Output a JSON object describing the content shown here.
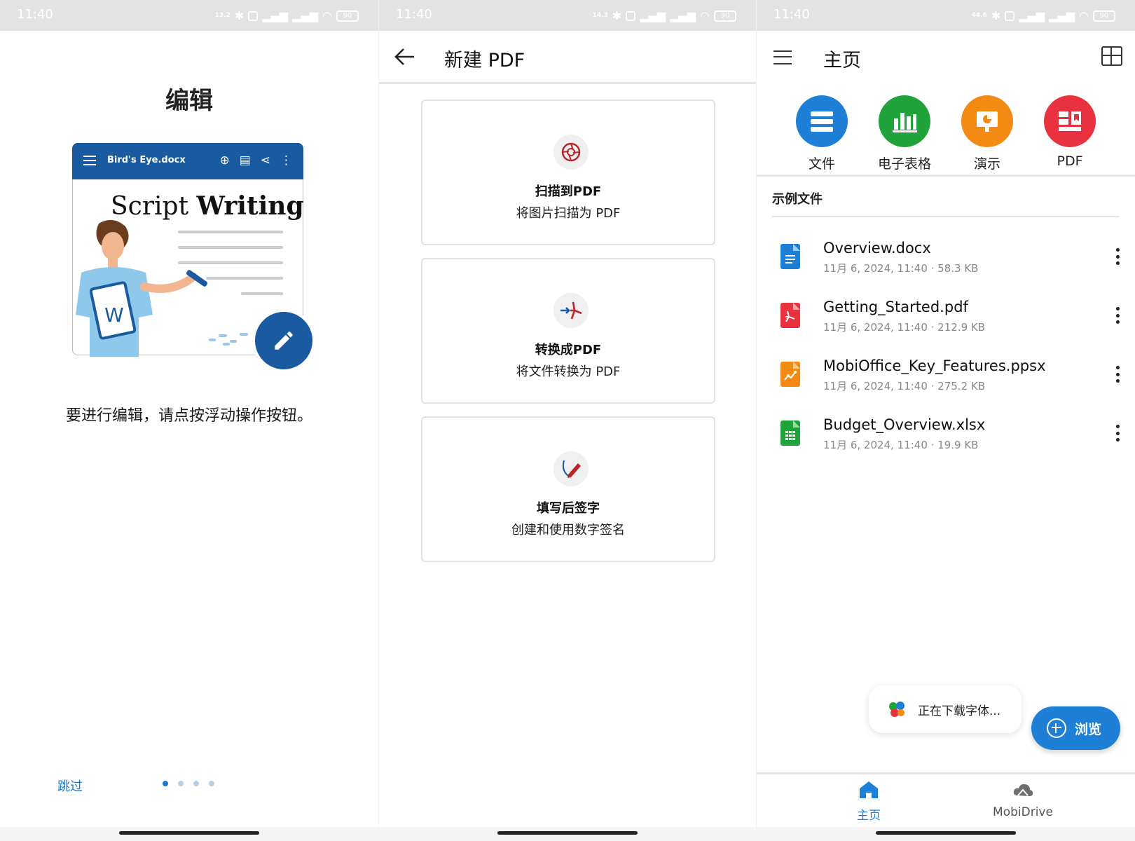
{
  "status_bar": {
    "time": "11:40",
    "net_speeds": [
      "13.2",
      "14.3",
      "44.6"
    ],
    "battery": "90"
  },
  "onboarding": {
    "title": "编辑",
    "doc_name": "Bird's Eye.docx",
    "doc_heading_part1": "Script",
    "doc_heading_part2": "Writing",
    "doc_badge_letter": "W",
    "instruction": "要进行编辑，请点按浮动操作按钮。",
    "skip_label": "跳过",
    "page_count": 4,
    "active_page": 1,
    "accent": "#1a5aa0"
  },
  "new_pdf": {
    "title": "新建 PDF",
    "options": [
      {
        "title": "扫描到PDF",
        "subtitle": "将图片扫描为 PDF",
        "icon": "camera-aperture-icon"
      },
      {
        "title": "转换成PDF",
        "subtitle": "将文件转换为 PDF",
        "icon": "convert-pdf-icon"
      },
      {
        "title": "填写后签字",
        "subtitle": "创建和使用数字签名",
        "icon": "pen-sign-icon"
      }
    ]
  },
  "home": {
    "title": "主页",
    "categories": [
      {
        "label": "文件",
        "color": "#1e7fd6",
        "icon": "document-icon"
      },
      {
        "label": "电子表格",
        "color": "#1fa33a",
        "icon": "spreadsheet-icon"
      },
      {
        "label": "演示",
        "color": "#f28a13",
        "icon": "presentation-icon"
      },
      {
        "label": "PDF",
        "color": "#e8323f",
        "icon": "pdf-icon"
      }
    ],
    "section_title": "示例文件",
    "files": [
      {
        "name": "Overview.docx",
        "meta": "11月 6, 2024, 11:40 · 58.3 KB",
        "color": "#1e7fd6",
        "icon": "docx-file-icon"
      },
      {
        "name": "Getting_Started.pdf",
        "meta": "11月 6, 2024, 11:40 · 212.9 KB",
        "color": "#e8323f",
        "icon": "pdf-file-icon"
      },
      {
        "name": "MobiOffice_Key_Features.ppsx",
        "meta": "11月 6, 2024, 11:40 · 275.2 KB",
        "color": "#f28a13",
        "icon": "ppsx-file-icon"
      },
      {
        "name": "Budget_Overview.xlsx",
        "meta": "11月 6, 2024, 11:40 · 19.9 KB",
        "color": "#1fa33a",
        "icon": "xlsx-file-icon"
      }
    ],
    "toast": "正在下载字体...",
    "fab_label": "浏览",
    "bottom_nav": [
      {
        "label": "主页",
        "active": true,
        "icon": "home-icon"
      },
      {
        "label": "MobiDrive",
        "active": false,
        "icon": "cloud-icon"
      }
    ]
  }
}
